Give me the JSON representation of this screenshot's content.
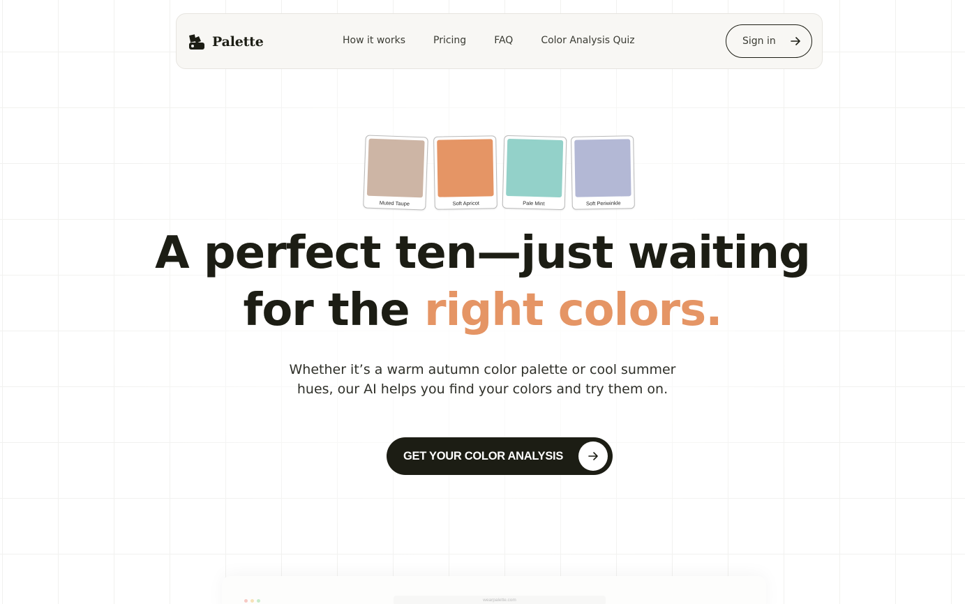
{
  "brand": {
    "name": "Palette"
  },
  "nav": {
    "links": [
      "How it works",
      "Pricing",
      "FAQ",
      "Color Analysis Quiz"
    ],
    "signin_label": "Sign in"
  },
  "swatches": [
    {
      "label": "Muted Taupe",
      "color": "#cdb5a5"
    },
    {
      "label": "Soft Apricot",
      "color": "#e59565"
    },
    {
      "label": "Pale Mint",
      "color": "#93d1c9"
    },
    {
      "label": "Soft Periwinkle",
      "color": "#b3b8d5"
    }
  ],
  "hero": {
    "headline_line1": "A perfect ten—just waiting",
    "headline_line2_plain": "for the ",
    "headline_line2_accent": "right colors.",
    "subtext_line1": "Whether it’s a warm autumn color palette or cool summer",
    "subtext_line2": "hues, our AI helps you find your colors and try them on.",
    "cta_label": "GET YOUR COLOR ANALYSIS"
  },
  "preview": {
    "url": "wearpalette.com"
  },
  "colors": {
    "accent": "#e59565",
    "dark": "#1c1d14",
    "nav_bg": "#f8f7f4"
  }
}
